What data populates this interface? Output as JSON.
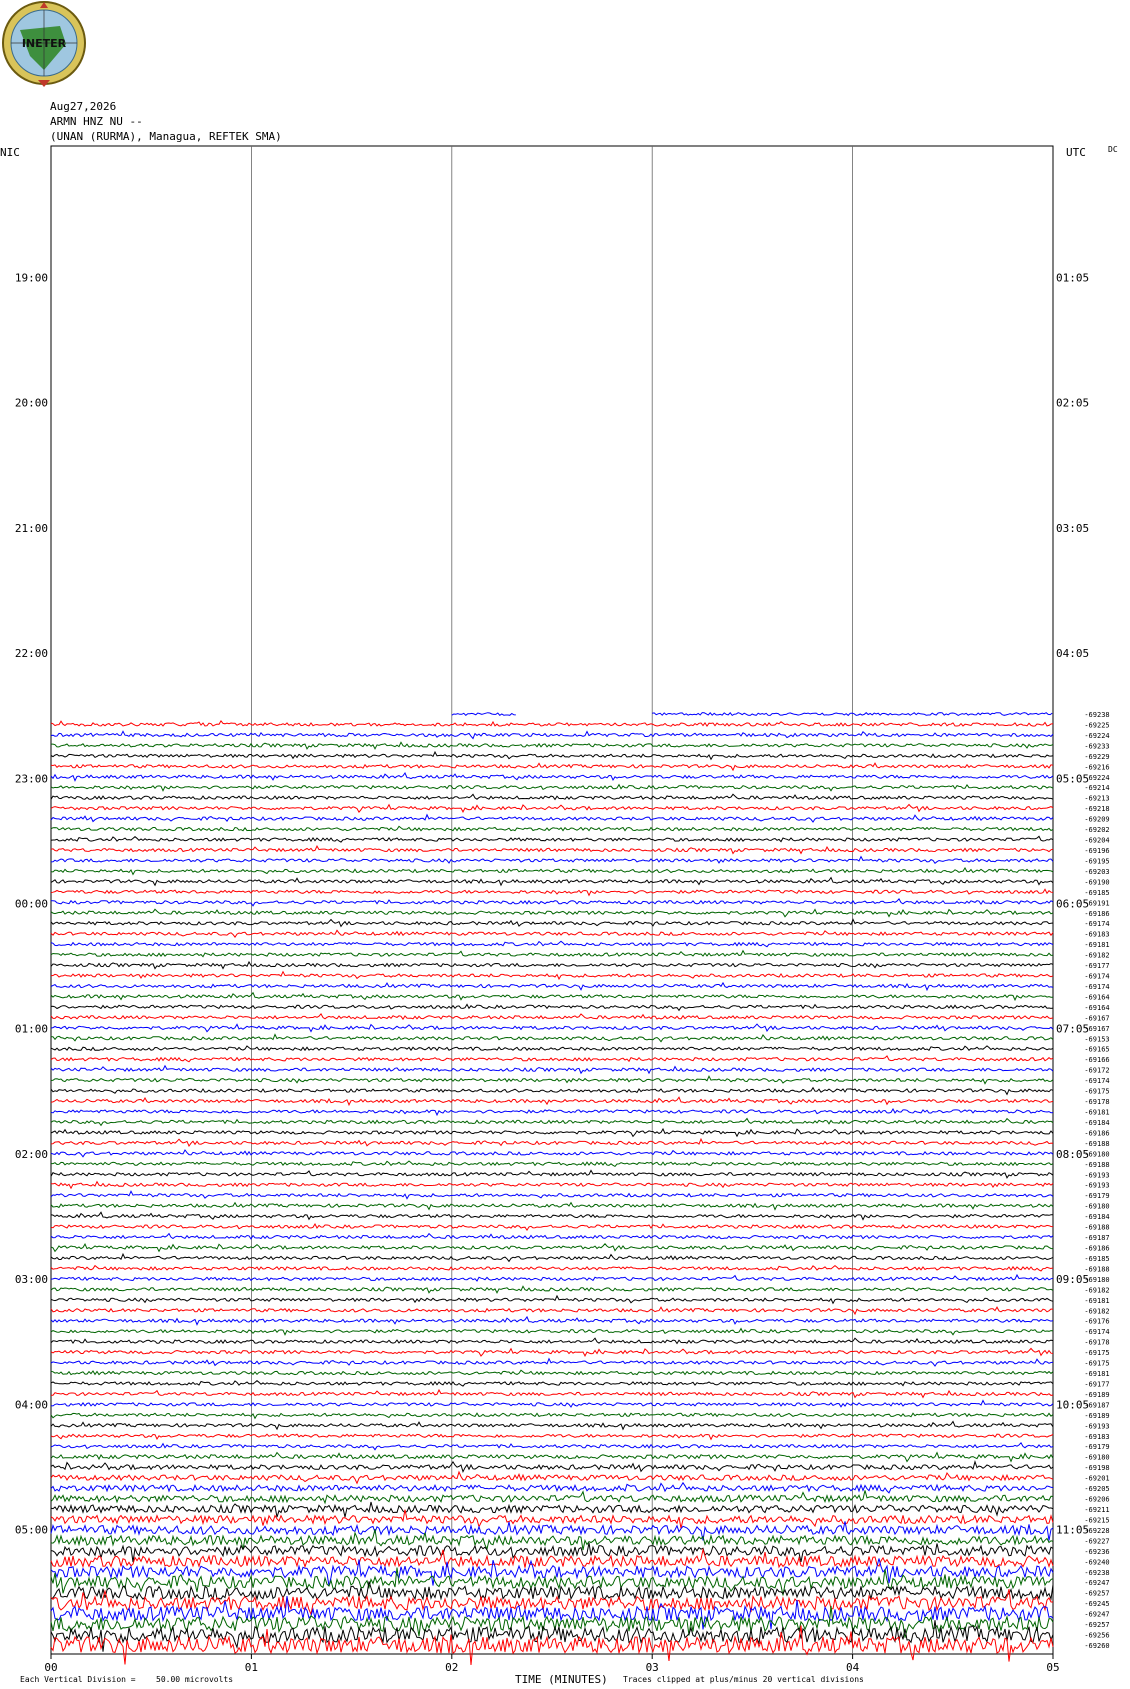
{
  "header": {
    "date": "Aug27,2026",
    "station": "ARMN HNZ NU --",
    "location": "(UNAN (RURMA), Managua, REFTEK SMA)",
    "left_tz": "NIC",
    "right_tz": "UTC",
    "dc_label": "DC",
    "logo_text": "INETER"
  },
  "time_labels": {
    "left": [
      "19:00",
      "20:00",
      "21:00",
      "22:00",
      "23:00",
      "00:00",
      "01:00",
      "02:00",
      "03:00",
      "04:00",
      "05:00"
    ],
    "right": [
      "01:05",
      "02:05",
      "03:05",
      "04:05",
      "05:05",
      "06:05",
      "07:05",
      "08:05",
      "09:05",
      "10:05",
      "11:05"
    ]
  },
  "x_ticks": [
    "00",
    "01",
    "02",
    "03",
    "04",
    "05"
  ],
  "footer": {
    "scale_label": "Each Vertical Division =",
    "scale_value": "50.00 microvolts",
    "axis_title": "TIME (MINUTES)",
    "clip_note": "Traces clipped at plus/minus 20 vertical divisions"
  },
  "trace_colors": [
    "#006400",
    "#000000",
    "#ff0000",
    "#0000ff"
  ],
  "dc_values": [
    "-69238",
    "-69225",
    "-69224",
    "-69233",
    "-69229",
    "-69216",
    "-69224",
    "-69214",
    "-69213",
    "-69218",
    "-69209",
    "-69202",
    "-69204",
    "-69196",
    "-69195",
    "-69203",
    "-69190",
    "-69185",
    "-69191",
    "-69186",
    "-69174",
    "-69183",
    "-69181",
    "-69182",
    "-69177",
    "-69174",
    "-69174",
    "-69164",
    "-69164",
    "-69167",
    "-69167",
    "-69153",
    "-69165",
    "-69166",
    "-69172",
    "-69174",
    "-69175",
    "-69178",
    "-69181",
    "-69184",
    "-69186",
    "-69188",
    "-69180",
    "-69188",
    "-69193",
    "-69193",
    "-69179",
    "-69180",
    "-69184",
    "-69188",
    "-69187",
    "-69186",
    "-69185",
    "-69188",
    "-69180",
    "-69182",
    "-69181",
    "-69182",
    "-69176",
    "-69174",
    "-69178",
    "-69175",
    "-69175",
    "-69181",
    "-69177",
    "-69189",
    "-69187",
    "-69189",
    "-69193",
    "-69183",
    "-69179",
    "-69180",
    "-69198",
    "-69201",
    "-69205",
    "-69206",
    "-69211",
    "-69215",
    "-69228",
    "-69227",
    "-69236",
    "-69240",
    "-69238",
    "-69247",
    "-69257",
    "-69245",
    "-69247",
    "-69257",
    "-69256",
    "-69260"
  ]
}
